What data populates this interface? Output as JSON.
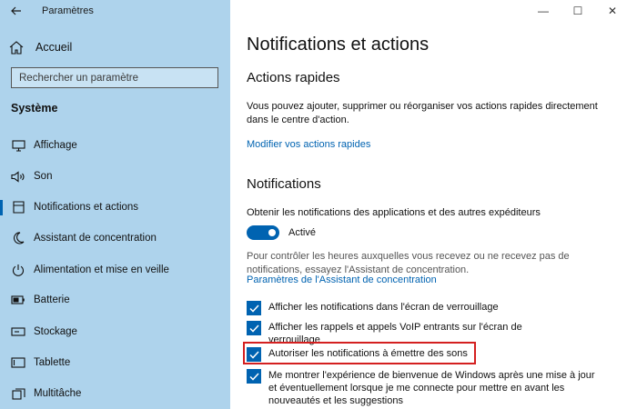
{
  "window": {
    "app_title": "Paramètres",
    "back_icon": "back-arrow-icon",
    "controls": [
      "minimize-icon",
      "maximize-icon",
      "close-icon"
    ],
    "controls_glyphs": [
      "—",
      "☐",
      "✕"
    ]
  },
  "sidebar": {
    "home_label": "Accueil",
    "search_placeholder": "Rechercher un paramètre",
    "section_title": "Système",
    "items": [
      {
        "label": "Affichage",
        "icon": "display-icon",
        "active": false
      },
      {
        "label": "Son",
        "icon": "speaker-icon",
        "active": false
      },
      {
        "label": "Notifications et actions",
        "icon": "notification-icon",
        "active": true
      },
      {
        "label": "Assistant de concentration",
        "icon": "moon-icon",
        "active": false
      },
      {
        "label": "Alimentation et mise en veille",
        "icon": "power-icon",
        "active": false
      },
      {
        "label": "Batterie",
        "icon": "battery-icon",
        "active": false
      },
      {
        "label": "Stockage",
        "icon": "storage-icon",
        "active": false
      },
      {
        "label": "Tablette",
        "icon": "tablet-icon",
        "active": false
      },
      {
        "label": "Multitâche",
        "icon": "multitask-icon",
        "active": false
      }
    ]
  },
  "main": {
    "title": "Notifications et actions",
    "quick_actions": {
      "heading": "Actions rapides",
      "description": "Vous pouvez ajouter, supprimer ou réorganiser vos actions rapides directement dans le centre d'action.",
      "link": "Modifier vos actions rapides"
    },
    "notifications": {
      "heading": "Notifications",
      "toggle_caption": "Obtenir les notifications des applications et des autres expéditeurs",
      "toggle_state_label": "Activé",
      "toggle_on": true,
      "focus_description": "Pour contrôler les heures auxquelles vous recevez ou ne recevez pas de notifications, essayez l'Assistant de concentration.",
      "focus_link": "Paramètres de l'Assistant de concentration",
      "checkboxes": [
        {
          "label": "Afficher les notifications dans l'écran de verrouillage",
          "checked": true
        },
        {
          "label": "Afficher les rappels et appels VoIP entrants sur l'écran de verrouillage",
          "checked": true
        },
        {
          "label": "Autoriser les notifications à émettre des sons",
          "checked": true,
          "highlighted": true
        },
        {
          "label": "Me montrer l'expérience de bienvenue de Windows après une mise à jour et éventuellement lorsque je me connecte pour mettre en avant les nouveautés et les suggestions",
          "checked": true
        }
      ]
    }
  },
  "colors": {
    "sidebar_bg": "#aed3ec",
    "accent": "#0063b1",
    "highlight_border": "#d42020"
  }
}
